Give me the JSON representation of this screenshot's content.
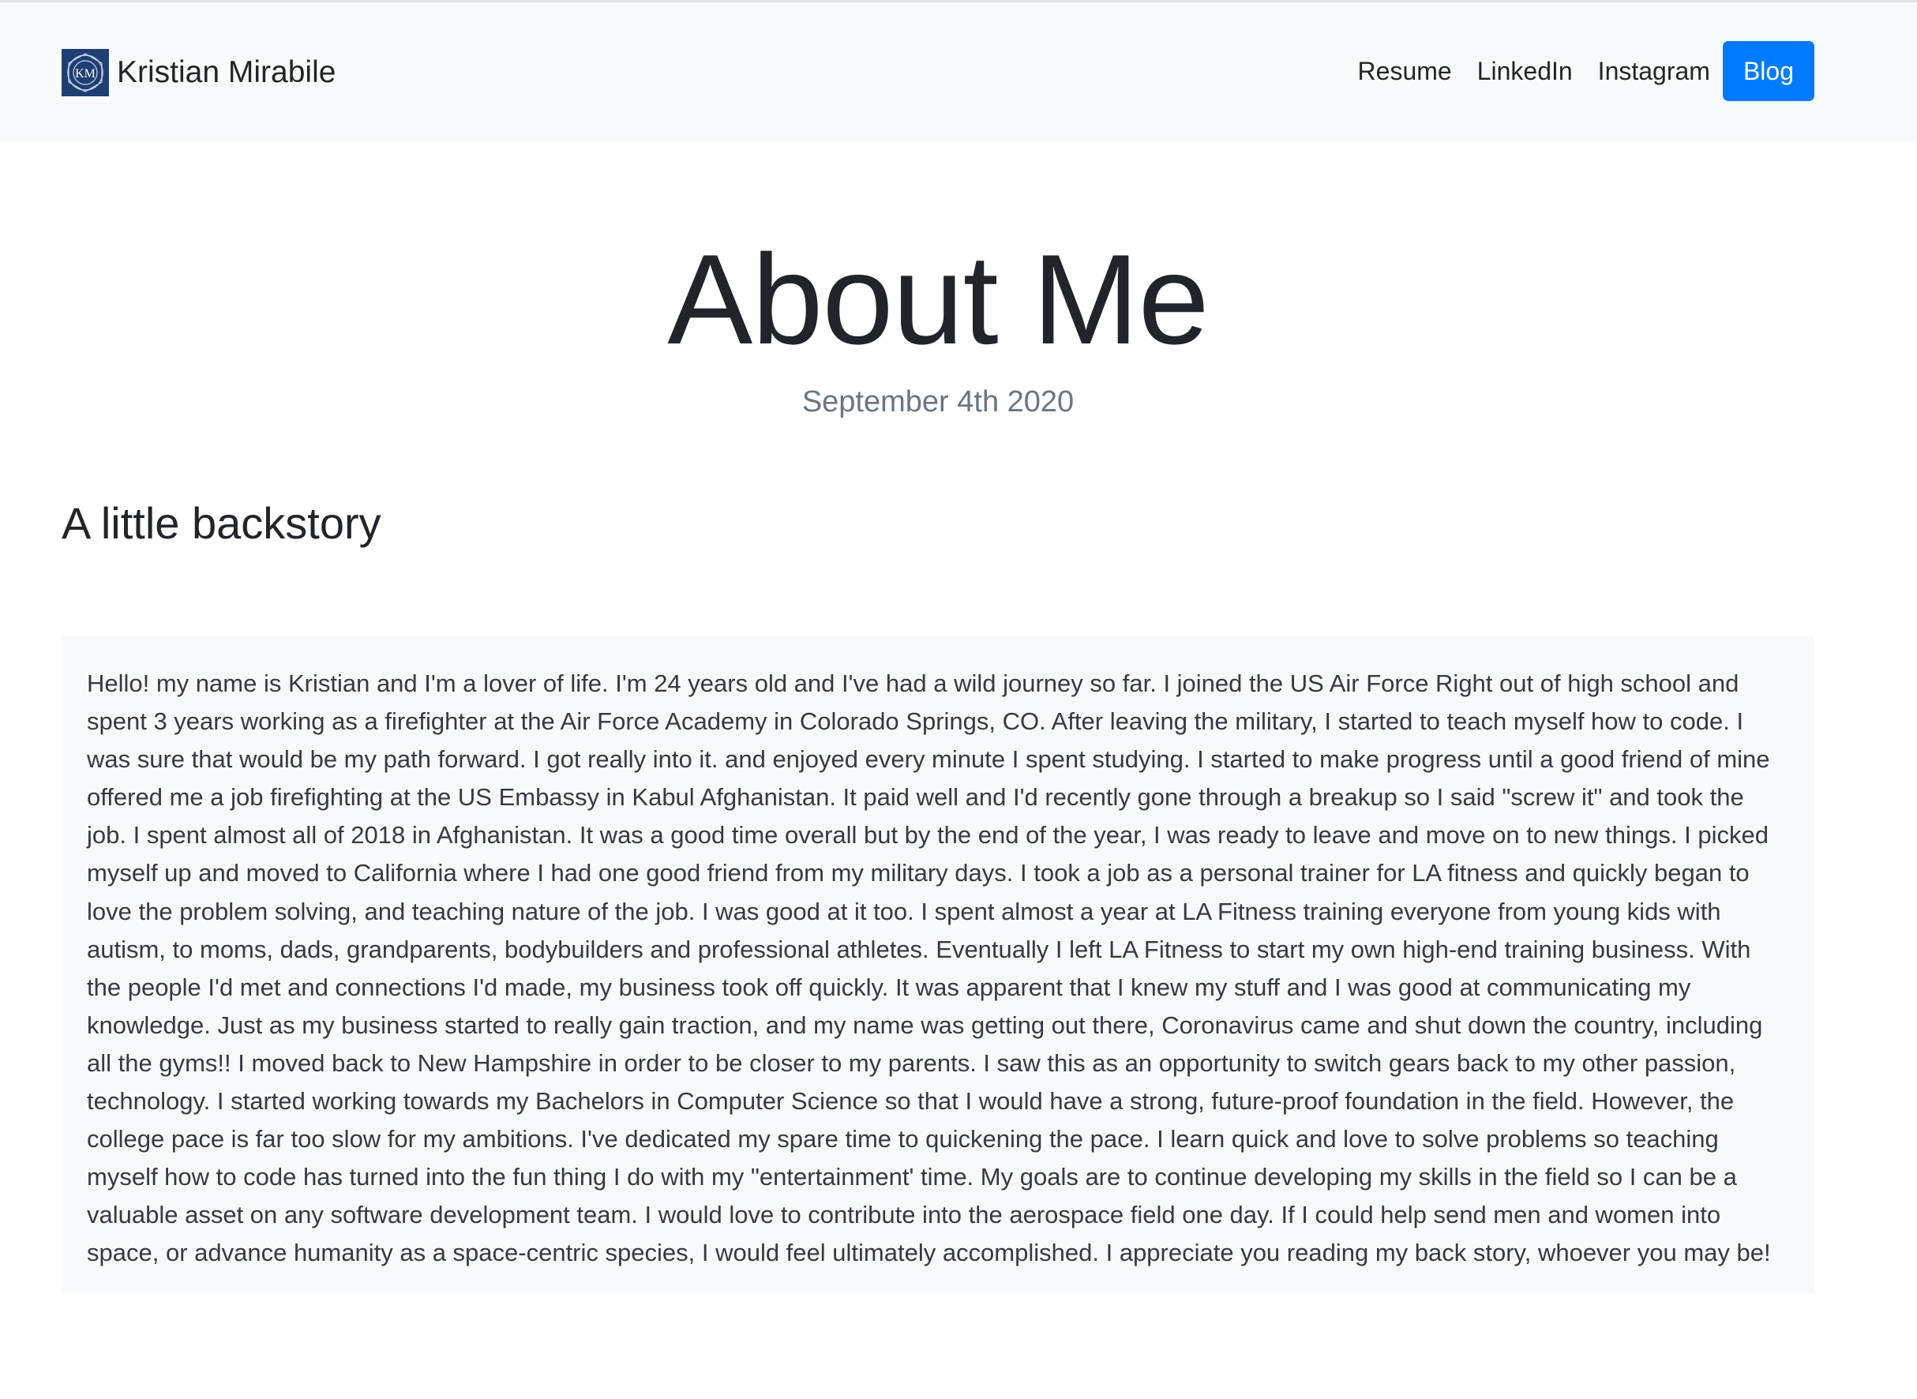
{
  "navbar": {
    "brand_name": "Kristian Mirabile",
    "brand_logo_text": "KM",
    "links": [
      {
        "label": "Resume"
      },
      {
        "label": "LinkedIn"
      },
      {
        "label": "Instagram"
      }
    ],
    "active_button": "Blog",
    "accent_color": "#007bff",
    "logo_color": "#1f3f73"
  },
  "main": {
    "title": "About Me",
    "date": "September 4th 2020",
    "section_heading": "A little backstory",
    "story": "Hello! my name is Kristian and I'm a lover of life. I'm 24 years old and I've had a wild journey so far. I joined the US Air Force Right out of high school and spent 3 years working as a firefighter at the Air Force Academy in Colorado Springs, CO. After leaving the military, I started to teach myself how to code. I was sure that would be my path forward. I got really into it. and enjoyed every minute I spent studying. I started to make progress until a good friend of mine offered me a job firefighting at the US Embassy in Kabul Afghanistan. It paid well and I'd recently gone through a breakup so I said \"screw it\" and took the job. I spent almost all of 2018 in Afghanistan. It was a good time overall but by the end of the year, I was ready to leave and move on to new things. I picked myself up and moved to California where I had one good friend from my military days. I took a job as a personal trainer for LA fitness and quickly began to love the problem solving, and teaching nature of the job. I was good at it too. I spent almost a year at LA Fitness training everyone from young kids with autism, to moms, dads, grandparents, bodybuilders and professional athletes. Eventually I left LA Fitness to start my own high-end training business. With the people I'd met and connections I'd made, my business took off quickly. It was apparent that I knew my stuff and I was good at communicating my knowledge. Just as my business started to really gain traction, and my name was getting out there, Coronavirus came and shut down the country, including all the gyms!! I moved back to New Hampshire in order to be closer to my parents. I saw this as an opportunity to switch gears back to my other passion, technology. I started working towards my Bachelors in Computer Science so that I would have a strong, future-proof foundation in the field. However, the college pace is far too slow for my ambitions. I've dedicated my spare time to quickening the pace. I learn quick and love to solve problems so teaching myself how to code has turned into the fun thing I do with my \"entertainment' time. My goals are to continue developing my skills in the field so I can be a valuable asset on any software development team. I would love to contribute into the aerospace field one day. If I could help send men and women into space, or advance humanity as a space-centric species, I would feel ultimately accomplished. I appreciate you reading my back story, whoever you may be!"
  }
}
